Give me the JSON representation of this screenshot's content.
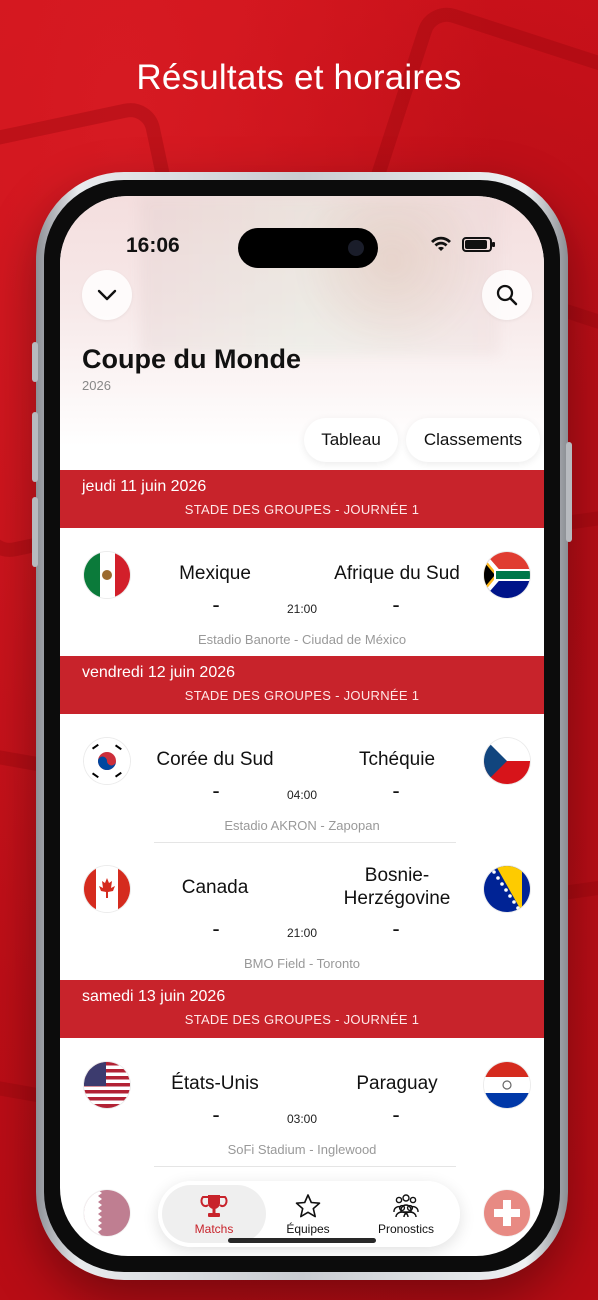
{
  "headline": "Résultats et horaires",
  "status": {
    "time": "16:06"
  },
  "header": {
    "title": "Coupe du Monde",
    "year": "2026",
    "pills": [
      "Tableau",
      "Classements"
    ]
  },
  "days": [
    {
      "date": "jeudi 11 juin 2026",
      "stage": "STADE DES GROUPES - JOURNÉE 1",
      "matches": [
        {
          "home": "Mexique",
          "away": "Afrique du Sud",
          "home_score": "-",
          "away_score": "-",
          "time": "21:00",
          "venue": "Estadio Banorte - Ciudad de México",
          "home_flag": "mexico-flag-icon",
          "away_flag": "south-africa-flag-icon"
        }
      ]
    },
    {
      "date": "vendredi 12 juin 2026",
      "stage": "STADE DES GROUPES - JOURNÉE 1",
      "matches": [
        {
          "home": "Corée du Sud",
          "away": "Tchéquie",
          "home_score": "-",
          "away_score": "-",
          "time": "04:00",
          "venue": "Estadio AKRON - Zapopan",
          "home_flag": "south-korea-flag-icon",
          "away_flag": "czechia-flag-icon"
        },
        {
          "home": "Canada",
          "away": "Bosnie-Herzégovine",
          "home_score": "-",
          "away_score": "-",
          "time": "21:00",
          "venue": "BMO Field - Toronto",
          "home_flag": "canada-flag-icon",
          "away_flag": "bosnia-flag-icon"
        }
      ]
    },
    {
      "date": "samedi 13 juin 2026",
      "stage": "STADE DES GROUPES - JOURNÉE 1",
      "matches": [
        {
          "home": "États-Unis",
          "away": "Paraguay",
          "home_score": "-",
          "away_score": "-",
          "time": "03:00",
          "venue": "SoFi Stadium - Inglewood",
          "home_flag": "usa-flag-icon",
          "away_flag": "paraguay-flag-icon"
        }
      ]
    }
  ],
  "tabbar": {
    "items": [
      {
        "label": "Matchs",
        "icon": "trophy-icon",
        "active": true
      },
      {
        "label": "Équipes",
        "icon": "star-icon",
        "active": false
      },
      {
        "label": "Pronostics",
        "icon": "people-icon",
        "active": false
      }
    ]
  },
  "colors": {
    "accent": "#c8232b",
    "background": "#c8101a"
  }
}
